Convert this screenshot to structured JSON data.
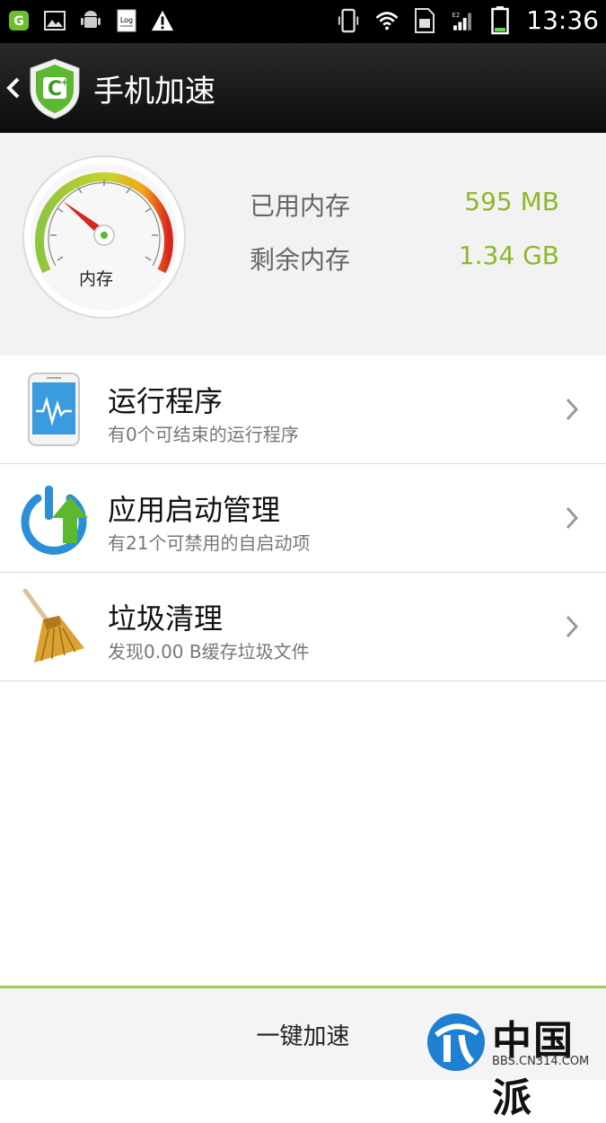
{
  "status_bar": {
    "time": "13:36",
    "left_icons": [
      "app-shield-icon",
      "gallery-icon",
      "android-debug-icon",
      "log-icon",
      "warning-icon"
    ],
    "right_icons": [
      "vibrate-icon",
      "wifi-icon",
      "sim-icon",
      "signal-e2-icon",
      "battery-icon"
    ]
  },
  "titlebar": {
    "title": "手机加速"
  },
  "memory": {
    "gauge_label": "内存",
    "used_label": "已用内存",
    "used_value": "595 MB",
    "free_label": "剩余内存",
    "free_value": "1.34 GB",
    "value_color": "#8db82b"
  },
  "items": [
    {
      "title": "运行程序",
      "subtitle": "有0个可结束的运行程序",
      "icon": "phone-monitor-icon"
    },
    {
      "title": "应用启动管理",
      "subtitle": "有21个可禁用的自启动项",
      "icon": "power-up-icon"
    },
    {
      "title": "垃圾清理",
      "subtitle": "发现0.00 B缓存垃圾文件",
      "icon": "broom-icon"
    }
  ],
  "bottom": {
    "button_label": "一键加速",
    "watermark_text": "中国派",
    "watermark_url": "BBS.CN314.COM"
  },
  "colors": {
    "accent": "#9ccd53",
    "title_bg": "#111111"
  }
}
